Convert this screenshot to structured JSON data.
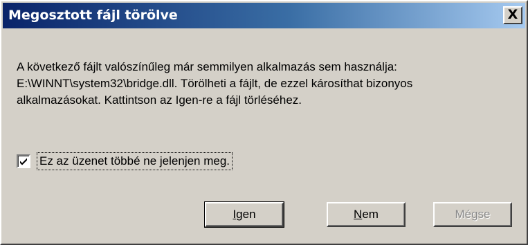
{
  "dialog": {
    "title": "Megosztott fájl törölve",
    "close_label": "X",
    "message_lines": [
      "A következő fájlt valószínűleg már semmilyen alkalmazás sem használja:",
      "E:\\WINNT\\system32\\bridge.dll. Törölheti a fájlt, de ezzel károsíthat bizonyos",
      "alkalmazásokat. Kattintson az Igen-re a fájl törléséhez."
    ],
    "checkbox": {
      "label": "Ez az üzenet többé ne jelenjen meg.",
      "checked": true
    },
    "buttons": {
      "yes": {
        "accel": "I",
        "rest": "gen"
      },
      "no": {
        "accel": "N",
        "rest": "em"
      },
      "cancel": {
        "label": "Mégse",
        "disabled": true
      }
    }
  }
}
